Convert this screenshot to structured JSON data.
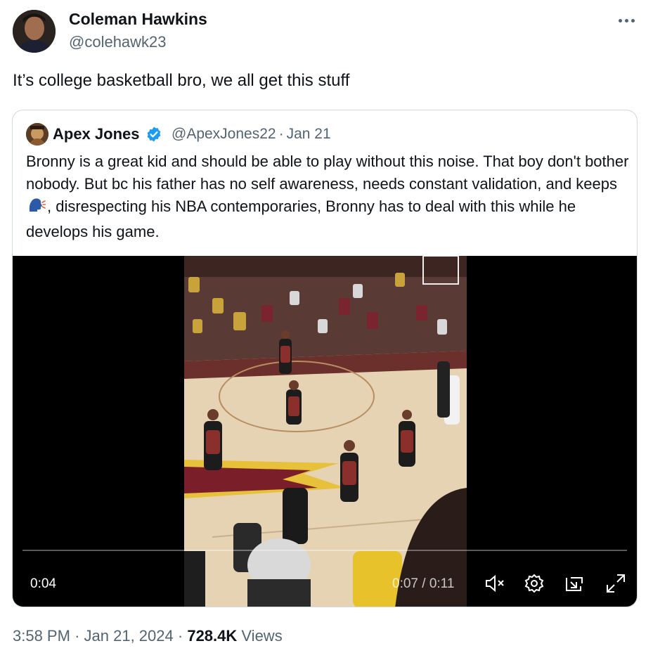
{
  "tweet": {
    "author_name": "Coleman Hawkins",
    "author_handle": "@colehawk23",
    "text": "It’s college basketball bro, we all get this stuff",
    "time": "3:58 PM",
    "date": "Jan 21, 2024",
    "views_count": "728.4K",
    "views_label": "Views",
    "separator": "·"
  },
  "quote": {
    "author_name": "Apex Jones",
    "author_handle": "@ApexJones22",
    "date": "Jan 21",
    "text_before_emoji": "Bronny is a great kid and should be able to play without this noise. That boy don't bother nobody. But bc his father has no self awareness, needs constant validation, and keeps",
    "text_after_emoji": ", disrespecting his NBA contemporaries, Bronny has to deal with this while he develops his game."
  },
  "video": {
    "current_time": "0:04",
    "total_time": "0:07 / 0:11",
    "progress": 0.36
  },
  "icons": {
    "more": "more-dots-icon",
    "verified": "verified-badge-icon",
    "emoji": "speaking-head-icon",
    "mute": "mute-icon",
    "settings": "gear-icon",
    "pip": "picture-in-picture-icon",
    "fullscreen": "fullscreen-icon"
  },
  "colors": {
    "verified_blue": "#1d9bf0",
    "text_primary": "#0f1419",
    "text_secondary": "#536471"
  }
}
